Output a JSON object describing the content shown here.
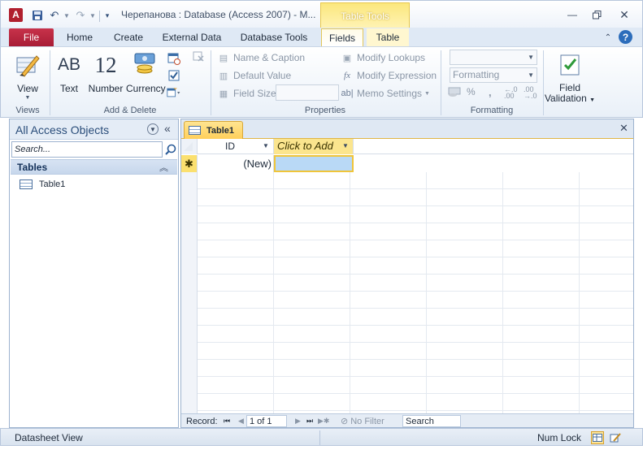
{
  "titlebar": {
    "app_icon_letter": "A",
    "title": "Черепанова : Database (Access 2007)  -  M...",
    "context_header": "Table Tools",
    "icons": {
      "save": "save-icon",
      "undo": "undo-icon",
      "redo": "redo-icon"
    }
  },
  "tabs": {
    "file": "File",
    "home": "Home",
    "create": "Create",
    "external": "External Data",
    "dbtools": "Database Tools",
    "fields": "Fields",
    "table": "Table"
  },
  "ribbon": {
    "views": {
      "view_label": "View",
      "group_label": "Views"
    },
    "add_delete": {
      "text_label": "Text",
      "text_icon_glyph": "AB",
      "number_label": "Number",
      "number_icon_glyph": "12",
      "currency_label": "Currency",
      "group_label": "Add & Delete"
    },
    "properties": {
      "name_caption": "Name & Caption",
      "default_value": "Default Value",
      "field_size": "Field Size",
      "modify_lookups": "Modify Lookups",
      "modify_expression": "Modify Expression",
      "memo_settings": "Memo Settings",
      "group_label": "Properties"
    },
    "formatting": {
      "data_type_value": "",
      "format_value": "Formatting",
      "percent": "%",
      "comma": ",",
      "group_label": "Formatting"
    },
    "field_validation": {
      "label_line1": "Field",
      "label_line2": "Validation"
    }
  },
  "navpane": {
    "title": "All Access Objects",
    "search_placeholder": "Search...",
    "group": "Tables",
    "items": [
      {
        "label": "Table1"
      }
    ]
  },
  "document": {
    "tab_label": "Table1",
    "columns": {
      "id": "ID",
      "add": "Click to Add"
    },
    "new_row": {
      "selector": "✱",
      "id_value": "(New)"
    },
    "record_nav": {
      "label": "Record:",
      "current": "1 of 1",
      "filter": "No Filter",
      "search": "Search"
    }
  },
  "status": {
    "left": "Datasheet View",
    "numlock": "Num Lock"
  },
  "colors": {
    "file_tab": "#b01f2e",
    "context_tab": "#fbe77d",
    "selection": "#b9d9f6",
    "header_highlight": "#fbe58e"
  }
}
